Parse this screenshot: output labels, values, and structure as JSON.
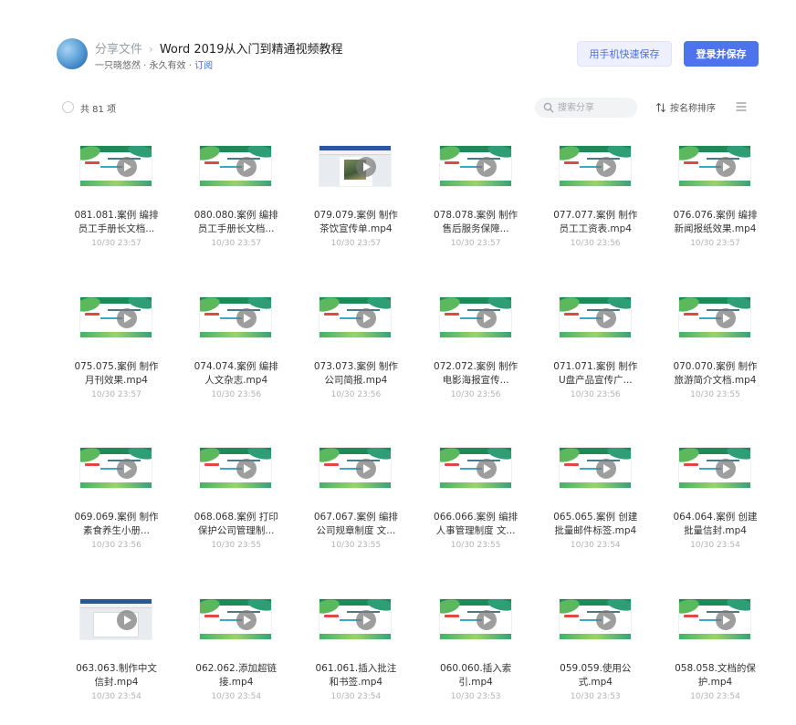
{
  "header": {
    "breadcrumb_root": "分享文件",
    "breadcrumb_sep": "›",
    "title": "Word 2019从入门到精通视频教程",
    "owner": "一只晓悠然",
    "meta_sep1": " · ",
    "validity": "永久有效",
    "meta_sep2": " · ",
    "subscribe": "订阅",
    "save_phone_label": "用手机快速保存",
    "login_save_label": "登录并保存"
  },
  "toolbar": {
    "count_text": "共 81 项",
    "search_placeholder": "搜索分享",
    "sort_label": "按名称排序"
  },
  "colors": {
    "accent": "#4e73ee",
    "link": "#3b6ee8",
    "secondary_button_bg": "#eef1fd"
  },
  "icons": {
    "search": "search-icon",
    "sort": "sort-icon",
    "menu": "list-menu-icon",
    "play": "play-icon"
  },
  "files": [
    {
      "line1": "081.081.案例 编排",
      "line2": "员工手册长文档...",
      "date": "10/30 23:57",
      "thumb": "slide"
    },
    {
      "line1": "080.080.案例 编排",
      "line2": "员工手册长文档...",
      "date": "10/30 23:57",
      "thumb": "slide"
    },
    {
      "line1": "079.079.案例 制作",
      "line2": "茶饮宣传单.mp4",
      "date": "10/30 23:57",
      "thumb": "doc-photo"
    },
    {
      "line1": "078.078.案例 制作",
      "line2": "售后服务保障...",
      "date": "10/30 23:57",
      "thumb": "slide"
    },
    {
      "line1": "077.077.案例 制作",
      "line2": "员工工资表.mp4",
      "date": "10/30 23:56",
      "thumb": "slide"
    },
    {
      "line1": "076.076.案例 编排",
      "line2": "新闻报纸效果.mp4",
      "date": "10/30 23:57",
      "thumb": "slide"
    },
    {
      "line1": "075.075.案例 制作",
      "line2": "月刊效果.mp4",
      "date": "10/30 23:57",
      "thumb": "slide"
    },
    {
      "line1": "074.074.案例 编排",
      "line2": "人文杂志.mp4",
      "date": "10/30 23:56",
      "thumb": "slide"
    },
    {
      "line1": "073.073.案例 制作",
      "line2": "公司简报.mp4",
      "date": "10/30 23:56",
      "thumb": "slide"
    },
    {
      "line1": "072.072.案例 制作",
      "line2": "电影海报宣传...",
      "date": "10/30 23:56",
      "thumb": "slide"
    },
    {
      "line1": "071.071.案例 制作",
      "line2": "U盘产品宣传广...",
      "date": "10/30 23:56",
      "thumb": "slide"
    },
    {
      "line1": "070.070.案例 制作",
      "line2": "旅游简介文档.mp4",
      "date": "10/30 23:55",
      "thumb": "slide"
    },
    {
      "line1": "069.069.案例 制作",
      "line2": "素食养生小册...",
      "date": "10/30 23:56",
      "thumb": "slide"
    },
    {
      "line1": "068.068.案例 打印",
      "line2": "保护公司管理制...",
      "date": "10/30 23:55",
      "thumb": "slide"
    },
    {
      "line1": "067.067.案例 编排",
      "line2": "公司规章制度 文...",
      "date": "10/30 23:55",
      "thumb": "slide"
    },
    {
      "line1": "066.066.案例 编排",
      "line2": "人事管理制度 文...",
      "date": "10/30 23:55",
      "thumb": "slide"
    },
    {
      "line1": "065.065.案例 创建",
      "line2": "批量邮件标签.mp4",
      "date": "10/30 23:54",
      "thumb": "slide"
    },
    {
      "line1": "064.064.案例 创建",
      "line2": "批量信封.mp4",
      "date": "10/30 23:54",
      "thumb": "slide"
    },
    {
      "line1": "063.063.制作中文",
      "line2": "信封.mp4",
      "date": "10/30 23:54",
      "thumb": "doc"
    },
    {
      "line1": "062.062.添加超链",
      "line2": "接.mp4",
      "date": "10/30 23:54",
      "thumb": "slide"
    },
    {
      "line1": "061.061.插入批注",
      "line2": "和书签.mp4",
      "date": "10/30 23:54",
      "thumb": "slide"
    },
    {
      "line1": "060.060.插入索",
      "line2": "引.mp4",
      "date": "10/30 23:53",
      "thumb": "slide"
    },
    {
      "line1": "059.059.使用公",
      "line2": "式.mp4",
      "date": "10/30 23:53",
      "thumb": "slide"
    },
    {
      "line1": "058.058.文档的保",
      "line2": "护.mp4",
      "date": "10/30 23:54",
      "thumb": "slide"
    }
  ]
}
